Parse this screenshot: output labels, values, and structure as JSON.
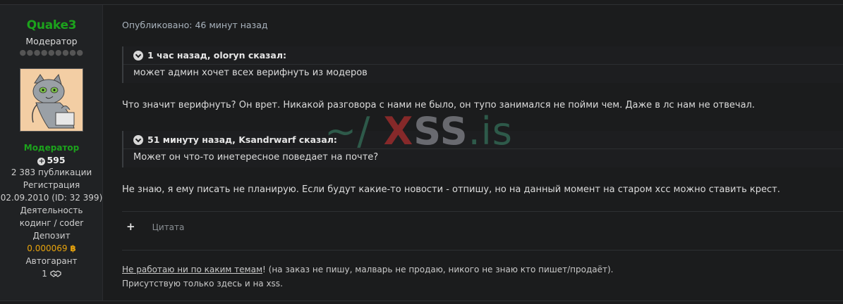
{
  "user": {
    "name": "Quake3",
    "title": "Модератор",
    "rank_dots": "●●●●●●●●●",
    "role_badge": "Модератор",
    "reaction_score": "595",
    "posts": "2 383 публикации",
    "reg_label": "Регистрация",
    "reg_value": "02.09.2010 (ID: 32 399)",
    "activity_label": "Деятельность",
    "activity_value": "кодинг / coder",
    "deposit_label": "Депозит",
    "deposit_value": "0.000069",
    "deposit_currency": "฿",
    "guarantee_label": "Автогарант",
    "guarantee_value": "1"
  },
  "post": {
    "published": "Опубликовано: 46 минут назад",
    "quote1": {
      "header": "1 час назад, oloryn сказал:",
      "body": "может админ хочет всех верифнуть из модеров"
    },
    "para1": "Что значит верифнуть? Он врет. Никакой разговора с нами не было, он тупо занимался не пойми чем. Даже в лс нам не отвечал.",
    "quote2": {
      "header": "51 минуту назад, Ksandrwarf сказал:",
      "body": "Может он что-то инетересное поведает на почте?"
    },
    "para2": "Не знаю, я ему писать не планирую. Если будут какие-то новости - отпишу, но на данный момент на старом хсс можно ставить крест.",
    "quote_action": "Цитата",
    "plus_symbol": "+"
  },
  "signature": {
    "link": "Не работаю ни по каким темам",
    "rest": "! (на заказ не пишу, малварь не продаю, никого не знаю кто пишет/продаёт).",
    "line2": "Присутствую только здесь и на xss."
  },
  "watermark": {
    "tilde": "~/",
    "x": "X",
    "ss": "SS",
    "is": ".is"
  },
  "colors": {
    "username": "#1ca31c",
    "deposit": "#e9a40c",
    "background": "#1b1c1d"
  }
}
